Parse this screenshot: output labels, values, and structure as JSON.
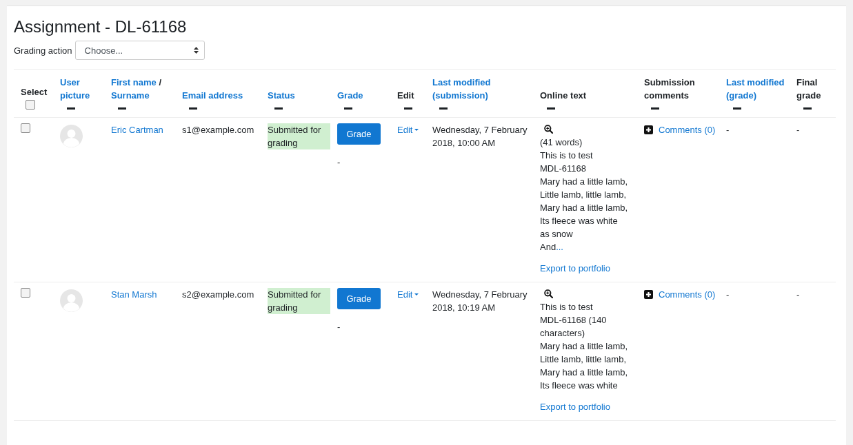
{
  "title": "Assignment - DL-61168",
  "grading_action": {
    "label": "Grading action",
    "placeholder": "Choose..."
  },
  "columns": [
    {
      "kind": "select",
      "label": "Select",
      "checked": false
    },
    {
      "kind": "link",
      "label": "User picture"
    },
    {
      "kind": "name",
      "first": "First name",
      "sep": "/",
      "last": "Surname"
    },
    {
      "kind": "link",
      "label": "Email address"
    },
    {
      "kind": "link",
      "label": "Status"
    },
    {
      "kind": "link",
      "label": "Grade"
    },
    {
      "kind": "plain",
      "label": "Edit"
    },
    {
      "kind": "link",
      "label": "Last modified (submission)"
    },
    {
      "kind": "plain",
      "label": "Online text"
    },
    {
      "kind": "plain",
      "label": "Submission comments"
    },
    {
      "kind": "link",
      "label": "Last modified (grade)"
    },
    {
      "kind": "plain",
      "label": "Final grade"
    }
  ],
  "rows": [
    {
      "checked": false,
      "name": "Eric Cartman",
      "email": "s1@example.com",
      "status": "Submitted for grading",
      "grade_button": "Grade",
      "grade": "-",
      "edit": "Edit",
      "modified": "Wednesday, 7 February 2018, 10:00 AM",
      "online_text": [
        "(41 words)",
        "This is to test",
        "MDL-61168",
        "Mary had a little lamb,",
        "Little lamb, little lamb,",
        "Mary had a little lamb,",
        "Its fleece was white",
        "as snow",
        "And"
      ],
      "more_link": "...",
      "export": "Export to portfolio",
      "comments": "Comments (0)",
      "grade_modified": "-",
      "final_grade": "-"
    },
    {
      "checked": false,
      "name": "Stan Marsh",
      "email": "s2@example.com",
      "status": "Submitted for grading",
      "grade_button": "Grade",
      "grade": "-",
      "edit": "Edit",
      "modified": "Wednesday, 7 February 2018, 10:19 AM",
      "online_text": [
        "This is to test",
        "MDL-61168 (140",
        "characters)",
        "Mary had a little lamb,",
        "Little lamb, little lamb,",
        "Mary had a little lamb,",
        "Its fleece was white"
      ],
      "export": "Export to portfolio",
      "comments": "Comments (0)",
      "grade_modified": "-",
      "final_grade": "-"
    }
  ]
}
